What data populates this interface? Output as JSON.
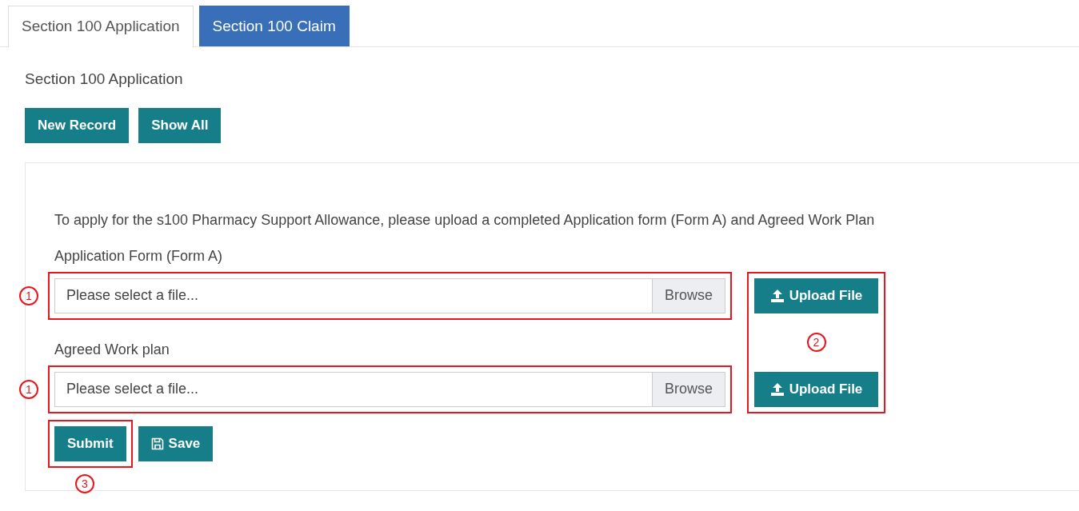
{
  "tabs": [
    {
      "label": "Section 100 Application",
      "selected": true
    },
    {
      "label": "Section 100 Claim",
      "selected": false
    }
  ],
  "heading": "Section 100 Application",
  "toolbar_buttons": [
    "New Record",
    "Show All"
  ],
  "form": {
    "instruction": "To apply for the s100 Pharmacy Support Allowance, please upload a completed Application form (Form A) and Agreed Work Plan",
    "file_fields": [
      {
        "label": "Application Form (Form A)",
        "placeholder": "Please select a file...",
        "browse": "Browse",
        "annotation": "1",
        "upload_button": "Upload File"
      },
      {
        "label": "Agreed Work plan",
        "placeholder": "Please select a file...",
        "browse": "Browse",
        "annotation": "1",
        "upload_button": "Upload File"
      }
    ],
    "upload_annotation": "2",
    "buttons": [
      {
        "label": "Submit",
        "kind": "submit",
        "annotation": "3"
      },
      {
        "label": "Save",
        "kind": "save"
      }
    ]
  }
}
